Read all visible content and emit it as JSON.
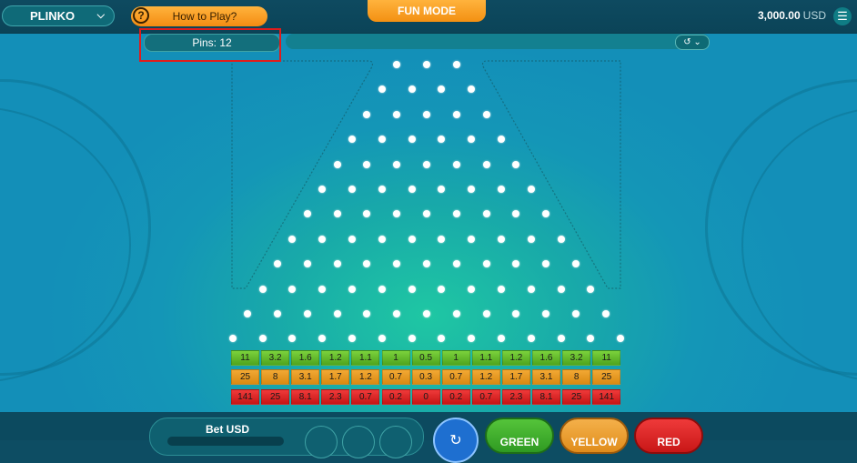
{
  "header": {
    "game_name": "PLINKO",
    "how_to_play": "How to Play?",
    "how_to_icon": "?",
    "mode": "FUN MODE",
    "balance": "3,000.00",
    "currency": "USD"
  },
  "board": {
    "pins_label": "Pins: 12",
    "pin_rows": 12,
    "multipliers": {
      "green": [
        "11",
        "3.2",
        "1.6",
        "1.2",
        "1.1",
        "1",
        "0.5",
        "1",
        "1.1",
        "1.2",
        "1.6",
        "3.2",
        "11"
      ],
      "yellow": [
        "25",
        "8",
        "3.1",
        "1.7",
        "1.2",
        "0.7",
        "0.3",
        "0.7",
        "1.2",
        "1.7",
        "3.1",
        "8",
        "25"
      ],
      "red": [
        "141",
        "25",
        "8.1",
        "2.3",
        "0.7",
        "0.2",
        "0",
        "0.2",
        "0.7",
        "2.3",
        "8.1",
        "25",
        "141"
      ]
    }
  },
  "controls": {
    "bet_label": "Bet USD",
    "green_label": "GREEN",
    "yellow_label": "YELLOW",
    "red_label": "RED"
  },
  "colors": {
    "accent_orange": "#f48c12",
    "green": "#4ea41e",
    "yellow": "#d98a12",
    "red": "#c61515"
  }
}
